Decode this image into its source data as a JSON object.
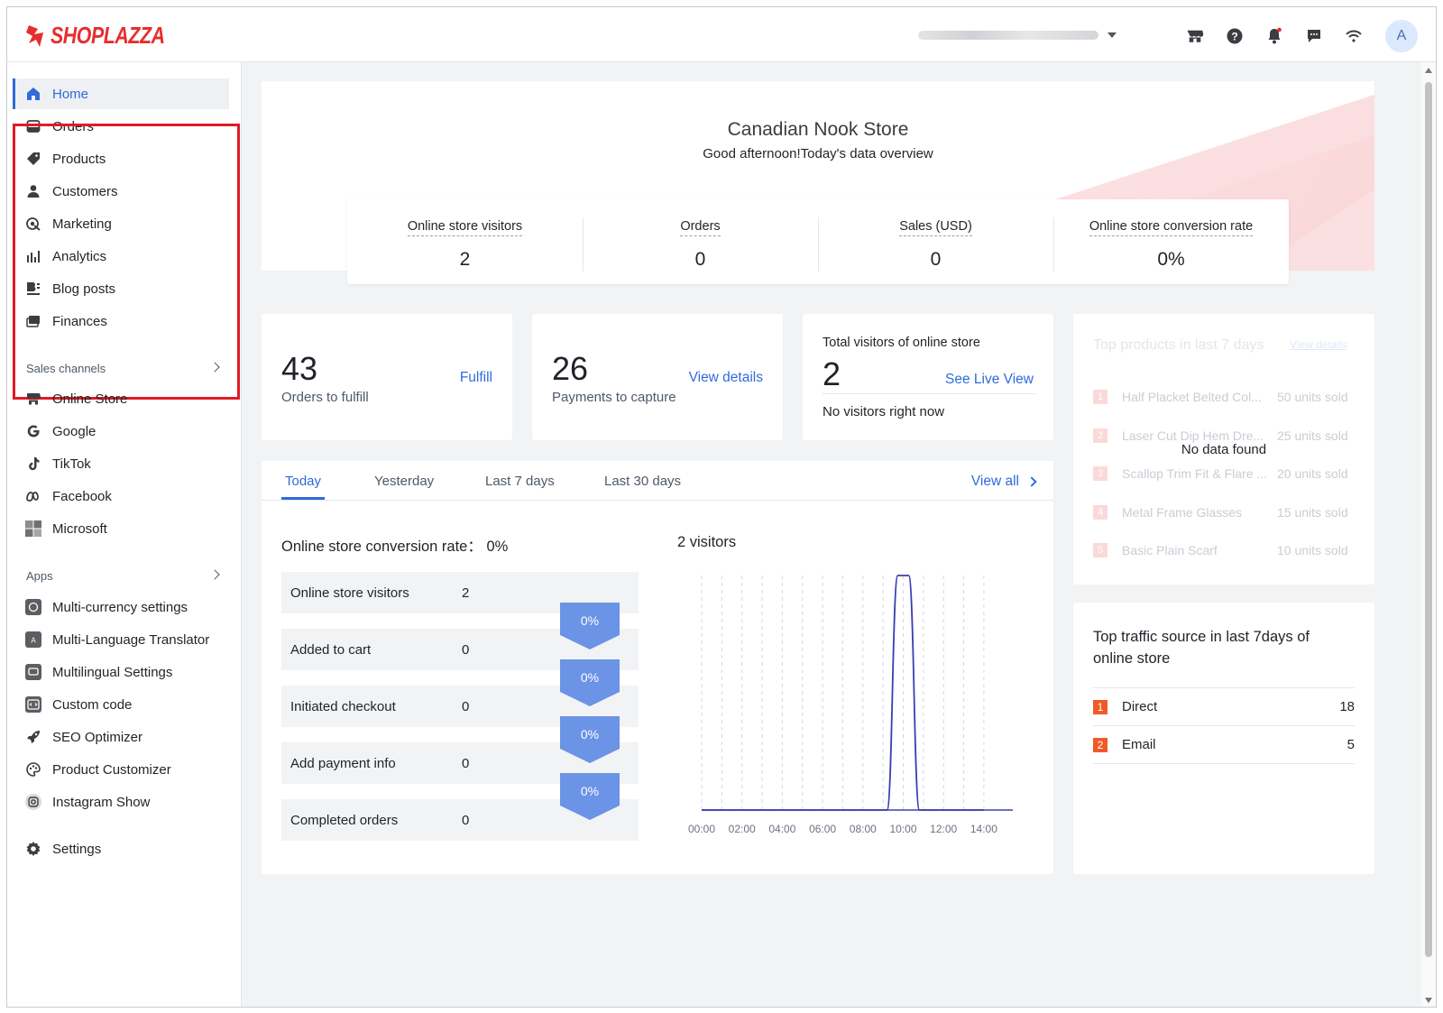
{
  "brand": {
    "name": "SHOPLAZZA",
    "color": "#e62e2e"
  },
  "header": {
    "icons": [
      "store-icon",
      "help-icon",
      "bell-icon",
      "message-icon",
      "wifi-icon"
    ],
    "avatar": "A"
  },
  "sidebar": {
    "main_items": [
      {
        "label": "Home",
        "icon": "home-icon",
        "active": true
      },
      {
        "label": "Orders",
        "icon": "orders-icon"
      },
      {
        "label": "Products",
        "icon": "tag-icon"
      },
      {
        "label": "Customers",
        "icon": "person-icon"
      },
      {
        "label": "Marketing",
        "icon": "marketing-icon"
      },
      {
        "label": "Analytics",
        "icon": "bar-chart-icon"
      },
      {
        "label": "Blog posts",
        "icon": "blog-icon"
      },
      {
        "label": "Finances",
        "icon": "finance-icon"
      }
    ],
    "sales_channels_label": "Sales channels",
    "sales_channels": [
      {
        "label": "Online Store",
        "icon": "store-icon"
      },
      {
        "label": "Google",
        "icon": "google-icon"
      },
      {
        "label": "TikTok",
        "icon": "tiktok-icon"
      },
      {
        "label": "Facebook",
        "icon": "meta-icon"
      },
      {
        "label": "Microsoft",
        "icon": "microsoft-icon"
      }
    ],
    "apps_label": "Apps",
    "apps": [
      {
        "label": "Multi-currency settings",
        "icon": "currency-icon"
      },
      {
        "label": "Multi-Language Translator",
        "icon": "translate-icon"
      },
      {
        "label": "Multilingual Settings",
        "icon": "language-icon"
      },
      {
        "label": "Custom code",
        "icon": "code-icon"
      },
      {
        "label": "SEO Optimizer",
        "icon": "rocket-icon"
      },
      {
        "label": "Product Customizer",
        "icon": "palette-icon"
      },
      {
        "label": "Instagram Show",
        "icon": "instagram-icon"
      }
    ],
    "settings_label": "Settings"
  },
  "hero": {
    "store_name": "Canadian Nook Store",
    "greeting": "Good afternoon!Today's data overview"
  },
  "stats": [
    {
      "label": "Online store visitors",
      "value": "2"
    },
    {
      "label": "Orders",
      "value": "0"
    },
    {
      "label": "Sales (USD)",
      "value": "0"
    },
    {
      "label": "Online store conversion rate",
      "value": "0%"
    }
  ],
  "fulfill_card": {
    "value": "43",
    "label": "Orders to fulfill",
    "link": "Fulfill"
  },
  "payments_card": {
    "value": "26",
    "label": "Payments to capture",
    "link": "View details"
  },
  "visitors_card": {
    "title": "Total visitors of online store",
    "value": "2",
    "link": "See Live View",
    "status": "No visitors right now"
  },
  "top_products": {
    "title": "Top products in last 7 days",
    "link": "View details",
    "empty": "No data found",
    "items": [
      {
        "rank": "1",
        "name": "Half Placket Belted Col...",
        "sold": "50 units sold"
      },
      {
        "rank": "2",
        "name": "Laser Cut Dip Hem Dre...",
        "sold": "25 units sold"
      },
      {
        "rank": "3",
        "name": "Scallop Trim Fit & Flare ...",
        "sold": "20 units sold"
      },
      {
        "rank": "4",
        "name": "Metal Frame Glasses",
        "sold": "15 units sold"
      },
      {
        "rank": "5",
        "name": "Basic Plain Scarf",
        "sold": "10 units sold"
      }
    ]
  },
  "tabs": {
    "items": [
      "Today",
      "Yesterday",
      "Last 7 days",
      "Last 30 days"
    ],
    "active": "Today",
    "view_all": "View all"
  },
  "funnel": {
    "title": "Online store conversion rate： 0%",
    "rows": [
      {
        "label": "Online store visitors",
        "value": "2"
      },
      {
        "label": "Added to cart",
        "value": "0"
      },
      {
        "label": "Initiated checkout",
        "value": "0"
      },
      {
        "label": "Add payment info",
        "value": "0"
      },
      {
        "label": "Completed orders",
        "value": "0"
      }
    ],
    "rates": [
      "0%",
      "0%",
      "0%",
      "0%"
    ]
  },
  "traffic": {
    "title_line1": "Top traffic source in last 7days of",
    "title_line2": "online store",
    "items": [
      {
        "rank": "1",
        "name": "Direct",
        "value": "18"
      },
      {
        "rank": "2",
        "name": "Email",
        "value": "5"
      }
    ]
  },
  "chart_data": {
    "type": "line",
    "title": "2 visitors",
    "x": [
      "00:00",
      "02:00",
      "04:00",
      "06:00",
      "08:00",
      "10:00",
      "12:00",
      "14:00"
    ],
    "series": [
      {
        "values": [
          0,
          0,
          0,
          0,
          0,
          2,
          0,
          0
        ]
      }
    ],
    "xlabel": "",
    "ylabel": "",
    "ylim": [
      0,
      2
    ],
    "grid": true,
    "line_color": "#3b3fb0"
  }
}
